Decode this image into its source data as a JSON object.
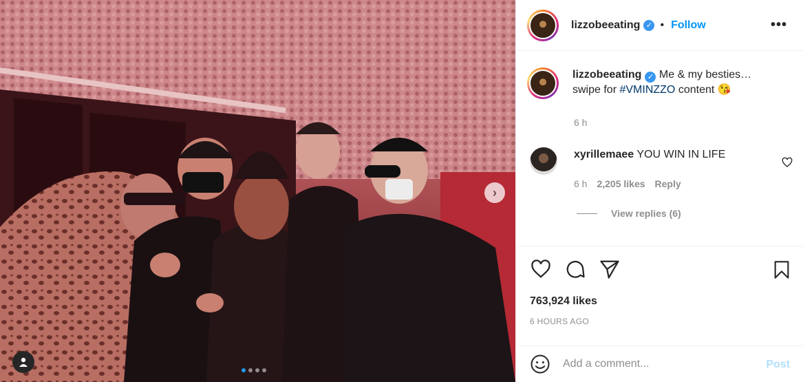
{
  "post": {
    "username": "lizzobeeating",
    "follow_label": "Follow",
    "more_label": "•••",
    "caption_text": "Me & my besties…\nswipe for",
    "caption_hashtag": "#VMINZZO",
    "caption_suffix": "content 😘",
    "caption_time": "6 h",
    "likes": "763,924 likes",
    "timestamp": "6 HOURS AGO"
  },
  "comment": {
    "username": "xyrillemaee",
    "text": "YOU WIN IN LIFE",
    "time": "6 h",
    "likes": "2,205 likes",
    "reply_label": "Reply",
    "view_replies": "View replies (6)"
  },
  "composer": {
    "placeholder": "Add a comment...",
    "post_label": "Post"
  },
  "carousel": {
    "count": 4,
    "active_index": 0
  },
  "icons": {
    "next": "chevron-right-icon",
    "tag": "user-tag-icon",
    "verified": "verified-badge-icon",
    "like": "heart-icon",
    "comment": "comment-icon",
    "share": "paper-plane-icon",
    "save": "bookmark-icon",
    "emoji": "emoji-icon"
  },
  "colors": {
    "accent": "#0095f6",
    "verified": "#3897f0",
    "post_disabled": "#b2dffc",
    "hashtag": "#00376b"
  }
}
